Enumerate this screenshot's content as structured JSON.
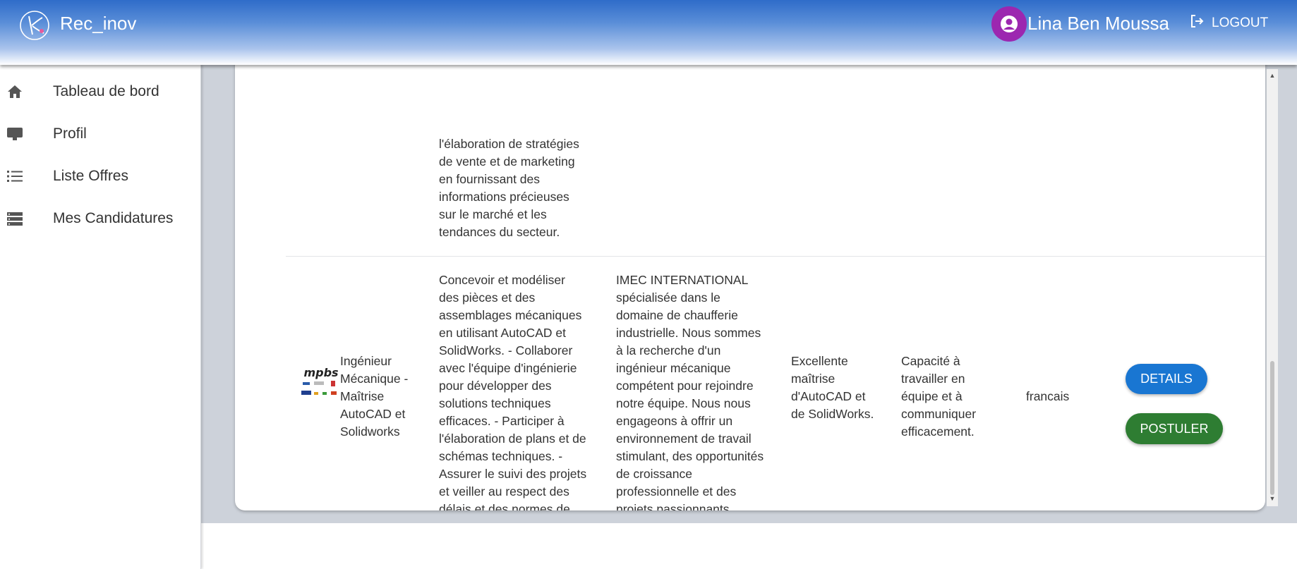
{
  "header": {
    "app_title": "Rec_inov",
    "user_name": "Lina Ben Moussa",
    "logout_label": "LOGOUT",
    "gradient_top": "#2f6cc9",
    "avatar_color": "#9c27b0"
  },
  "sidebar": {
    "items": [
      {
        "label": "Tableau de bord",
        "icon": "home-icon"
      },
      {
        "label": "Profil",
        "icon": "monitor-icon"
      },
      {
        "label": "Liste Offres",
        "icon": "list-icon"
      },
      {
        "label": "Mes Candidatures",
        "icon": "storage-icon"
      }
    ]
  },
  "offers": {
    "previous_row_description": "l'élaboration de stratégies de vente et de marketing en fournissant des informations précieuses sur le marché et les tendances du secteur.",
    "row": {
      "logo_text": "mpbs",
      "title": "Ingénieur Mécanique - Maîtrise AutoCAD et Solidworks",
      "description": "Concevoir et modéliser des pièces et des assemblages mécaniques en utilisant AutoCAD et SolidWorks. - Collaborer avec l'équipe d'ingénierie pour développer des solutions techniques efficaces. - Participer à l'élaboration de plans et de schémas techniques. - Assurer le suivi des projets et veiller au respect des délais et des normes de qualité.",
      "company": "IMEC INTERNATIONAL spécialisée dans le domaine de chaufferie industrielle. Nous sommes à la recherche d'un ingénieur mécanique compétent pour rejoindre notre équipe. Nous nous engageons à offrir un environnement de travail stimulant, des opportunités de croissance professionnelle et des projets passionnants.",
      "skills": "Excellente maîtrise d'AutoCAD et de SolidWorks.",
      "soft_skills": "Capacité à travailler en équipe et à communiquer efficacement.",
      "language": "francais",
      "details_label": "DETAILS",
      "apply_label": "POSTULER"
    },
    "colors": {
      "details": "#1976d2",
      "apply": "#2e7d32"
    }
  }
}
